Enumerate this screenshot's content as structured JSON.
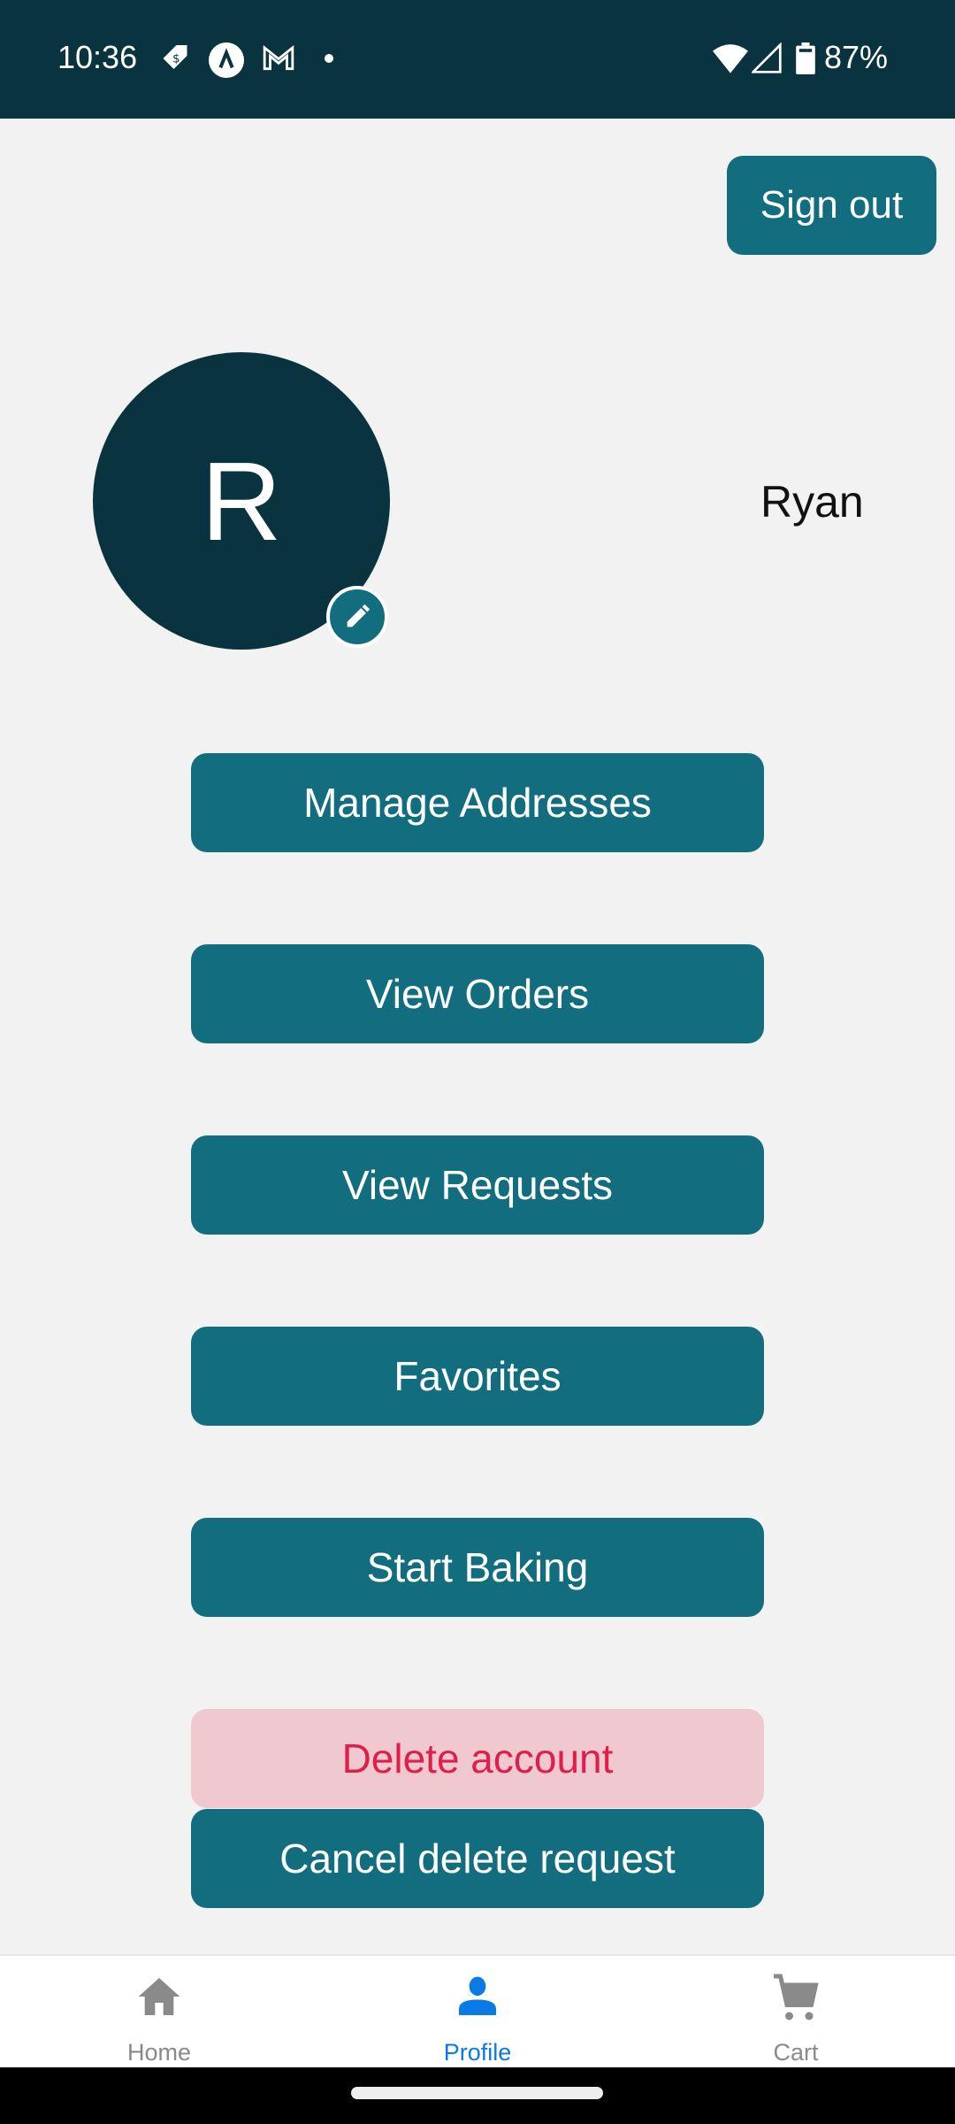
{
  "status_bar": {
    "time": "10:36",
    "battery_percent": "87%",
    "left_icons": [
      "price-tag-icon",
      "app-a-icon",
      "gmail-icon",
      "dot-icon"
    ],
    "right_icons": [
      "wifi-icon",
      "signal-icon",
      "battery-icon"
    ]
  },
  "header": {
    "sign_out_label": "Sign out"
  },
  "profile": {
    "avatar_initial": "R",
    "name": "Ryan",
    "edit_icon": "pencil-icon"
  },
  "menu": {
    "items": [
      {
        "label": "Manage Addresses"
      },
      {
        "label": "View Orders"
      },
      {
        "label": "View Requests"
      },
      {
        "label": "Favorites"
      },
      {
        "label": "Start Baking"
      }
    ],
    "delete_label": "Delete account",
    "cancel_delete_label": "Cancel delete request"
  },
  "bottom_nav": {
    "items": [
      {
        "label": "Home",
        "icon": "home-icon"
      },
      {
        "label": "Profile",
        "icon": "person-icon",
        "active": true
      },
      {
        "label": "Cart",
        "icon": "cart-icon"
      }
    ]
  },
  "colors": {
    "primary": "#126e7e",
    "dark": "#09333e",
    "danger_bg": "#f0c8cf",
    "danger_text": "#e01e4b",
    "nav_active": "#0a7ae6",
    "nav_inactive": "#8a8a8a"
  }
}
